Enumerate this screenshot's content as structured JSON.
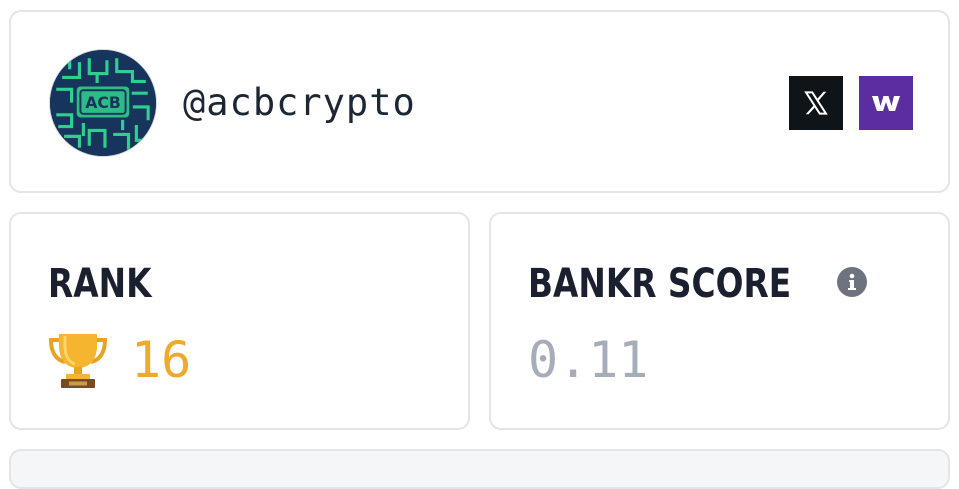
{
  "profile": {
    "handle": "@acbcrypto",
    "avatar_text": "ACB",
    "avatar_icon": "maze-avatar-icon",
    "links": [
      {
        "name": "x",
        "icon": "x-logo-icon",
        "color": "#0f1419"
      },
      {
        "name": "warpcast",
        "icon": "w-logo-icon",
        "color": "#5b2d9e"
      }
    ]
  },
  "rank": {
    "label": "RANK",
    "icon": "trophy-icon",
    "value": "16",
    "value_color": "#efaa2c"
  },
  "score": {
    "label": "BANKR SCORE",
    "info_icon": "info-icon",
    "value": "0.11",
    "value_color": "#a5adba"
  }
}
